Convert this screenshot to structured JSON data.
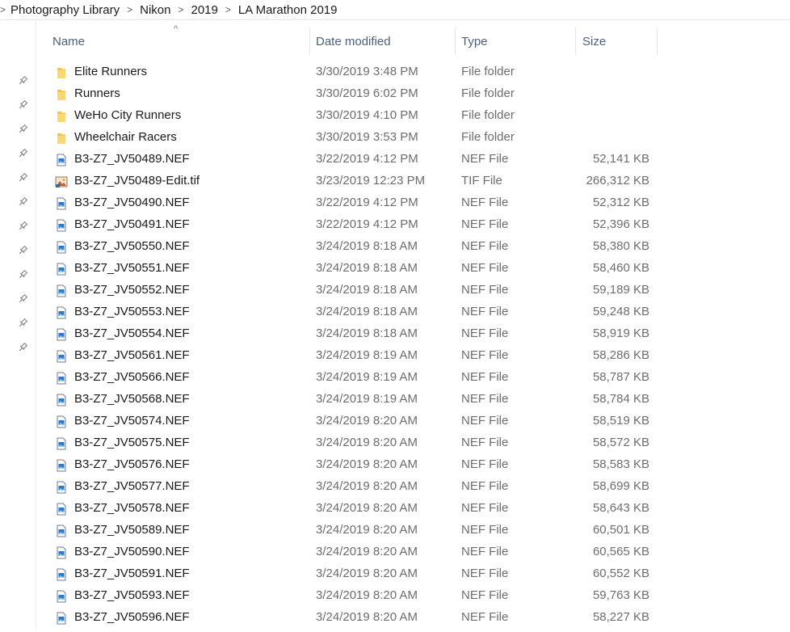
{
  "breadcrumb": {
    "items": [
      "Photography Library",
      "Nikon",
      "2019",
      "LA Marathon 2019"
    ]
  },
  "columns": {
    "name": "Name",
    "date": "Date modified",
    "type": "Type",
    "size": "Size"
  },
  "sort_indicator": "^",
  "separator_glyph": ">",
  "colors": {
    "header_text": "#4c607a",
    "folder": "#f4c542",
    "secondary_text": "#6d6d6d"
  },
  "files": [
    {
      "name": "Elite Runners",
      "date": "3/30/2019 3:48 PM",
      "type": "File folder",
      "size": "",
      "icon": "folder-icon"
    },
    {
      "name": "Runners",
      "date": "3/30/2019 6:02 PM",
      "type": "File folder",
      "size": "",
      "icon": "folder-icon"
    },
    {
      "name": "WeHo City Runners",
      "date": "3/30/2019 4:10 PM",
      "type": "File folder",
      "size": "",
      "icon": "folder-icon"
    },
    {
      "name": "Wheelchair Racers",
      "date": "3/30/2019 3:53 PM",
      "type": "File folder",
      "size": "",
      "icon": "folder-icon"
    },
    {
      "name": "B3-Z7_JV50489.NEF",
      "date": "3/22/2019 4:12 PM",
      "type": "NEF File",
      "size": "52,141 KB",
      "icon": "image-file-icon"
    },
    {
      "name": "B3-Z7_JV50489-Edit.tif",
      "date": "3/23/2019 12:23 PM",
      "type": "TIF File",
      "size": "266,312 KB",
      "icon": "tif-file-icon"
    },
    {
      "name": "B3-Z7_JV50490.NEF",
      "date": "3/22/2019 4:12 PM",
      "type": "NEF File",
      "size": "52,312 KB",
      "icon": "image-file-icon"
    },
    {
      "name": "B3-Z7_JV50491.NEF",
      "date": "3/22/2019 4:12 PM",
      "type": "NEF File",
      "size": "52,396 KB",
      "icon": "image-file-icon"
    },
    {
      "name": "B3-Z7_JV50550.NEF",
      "date": "3/24/2019 8:18 AM",
      "type": "NEF File",
      "size": "58,380 KB",
      "icon": "image-file-icon"
    },
    {
      "name": "B3-Z7_JV50551.NEF",
      "date": "3/24/2019 8:18 AM",
      "type": "NEF File",
      "size": "58,460 KB",
      "icon": "image-file-icon"
    },
    {
      "name": "B3-Z7_JV50552.NEF",
      "date": "3/24/2019 8:18 AM",
      "type": "NEF File",
      "size": "59,189 KB",
      "icon": "image-file-icon"
    },
    {
      "name": "B3-Z7_JV50553.NEF",
      "date": "3/24/2019 8:18 AM",
      "type": "NEF File",
      "size": "59,248 KB",
      "icon": "image-file-icon"
    },
    {
      "name": "B3-Z7_JV50554.NEF",
      "date": "3/24/2019 8:18 AM",
      "type": "NEF File",
      "size": "58,919 KB",
      "icon": "image-file-icon"
    },
    {
      "name": "B3-Z7_JV50561.NEF",
      "date": "3/24/2019 8:19 AM",
      "type": "NEF File",
      "size": "58,286 KB",
      "icon": "image-file-icon"
    },
    {
      "name": "B3-Z7_JV50566.NEF",
      "date": "3/24/2019 8:19 AM",
      "type": "NEF File",
      "size": "58,787 KB",
      "icon": "image-file-icon"
    },
    {
      "name": "B3-Z7_JV50568.NEF",
      "date": "3/24/2019 8:19 AM",
      "type": "NEF File",
      "size": "58,784 KB",
      "icon": "image-file-icon"
    },
    {
      "name": "B3-Z7_JV50574.NEF",
      "date": "3/24/2019 8:20 AM",
      "type": "NEF File",
      "size": "58,519 KB",
      "icon": "image-file-icon"
    },
    {
      "name": "B3-Z7_JV50575.NEF",
      "date": "3/24/2019 8:20 AM",
      "type": "NEF File",
      "size": "58,572 KB",
      "icon": "image-file-icon"
    },
    {
      "name": "B3-Z7_JV50576.NEF",
      "date": "3/24/2019 8:20 AM",
      "type": "NEF File",
      "size": "58,583 KB",
      "icon": "image-file-icon"
    },
    {
      "name": "B3-Z7_JV50577.NEF",
      "date": "3/24/2019 8:20 AM",
      "type": "NEF File",
      "size": "58,699 KB",
      "icon": "image-file-icon"
    },
    {
      "name": "B3-Z7_JV50578.NEF",
      "date": "3/24/2019 8:20 AM",
      "type": "NEF File",
      "size": "58,643 KB",
      "icon": "image-file-icon"
    },
    {
      "name": "B3-Z7_JV50589.NEF",
      "date": "3/24/2019 8:20 AM",
      "type": "NEF File",
      "size": "60,501 KB",
      "icon": "image-file-icon"
    },
    {
      "name": "B3-Z7_JV50590.NEF",
      "date": "3/24/2019 8:20 AM",
      "type": "NEF File",
      "size": "60,565 KB",
      "icon": "image-file-icon"
    },
    {
      "name": "B3-Z7_JV50591.NEF",
      "date": "3/24/2019 8:20 AM",
      "type": "NEF File",
      "size": "60,552 KB",
      "icon": "image-file-icon"
    },
    {
      "name": "B3-Z7_JV50593.NEF",
      "date": "3/24/2019 8:20 AM",
      "type": "NEF File",
      "size": "59,763 KB",
      "icon": "image-file-icon"
    },
    {
      "name": "B3-Z7_JV50596.NEF",
      "date": "3/24/2019 8:20 AM",
      "type": "NEF File",
      "size": "58,227 KB",
      "icon": "image-file-icon"
    }
  ],
  "pinned_count": 12
}
